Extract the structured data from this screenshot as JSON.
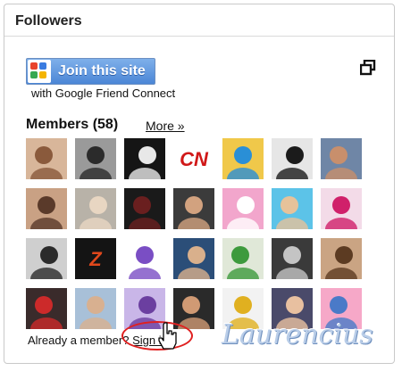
{
  "widget": {
    "title": "Followers",
    "join_button_label": "Join this site",
    "friend_connect_text": "with Google Friend Connect",
    "members_title": "Members (58)",
    "more_link": "More »",
    "footer_text": "Already a member? ",
    "sign_in_link": "Sign in",
    "watermark": "Laurencius"
  },
  "icons": {
    "logo": "google-friend-connect-icon",
    "popout": "popout-icon",
    "cursor": "hand-cursor-icon"
  },
  "colors": {
    "join_button": "#4b86d6",
    "highlight_circle": "#e02020",
    "watermark": "#b9cde8"
  },
  "members": [
    {
      "avatar": "#d8b69a",
      "accent": "#8a5a3c"
    },
    {
      "avatar": "#9a9a9a",
      "accent": "#2b2b2b"
    },
    {
      "avatar": "#151515",
      "accent": "#e8e8e8"
    },
    {
      "avatar": "#ffffff",
      "accent": "#d01818",
      "text": "CN"
    },
    {
      "avatar": "#f0c84a",
      "accent": "#2a8fd6"
    },
    {
      "avatar": "#e6e6e6",
      "accent": "#1b1b1b"
    },
    {
      "avatar": "#6f86a6",
      "accent": "#c88f6c"
    },
    {
      "avatar": "#c9a184",
      "accent": "#5a3a2a"
    },
    {
      "avatar": "#b8b2a8",
      "accent": "#e8d6c2"
    },
    {
      "avatar": "#1a1a1a",
      "accent": "#6a1f1f"
    },
    {
      "avatar": "#3b3b3b",
      "accent": "#d2a27f"
    },
    {
      "avatar": "#f2a6cc",
      "accent": "#ffffff"
    },
    {
      "avatar": "#5cc3e8",
      "accent": "#e6c29a"
    },
    {
      "avatar": "#f3dbe8",
      "accent": "#d0206a"
    },
    {
      "avatar": "#cfcfcf",
      "accent": "#2b2b2b"
    },
    {
      "avatar": "#141414",
      "accent": "#e0481c",
      "text": "Z"
    },
    {
      "avatar": "#ffffff",
      "accent": "#7a4ec4"
    },
    {
      "avatar": "#2b4e78",
      "accent": "#d9b08c"
    },
    {
      "avatar": "#e0e8d8",
      "accent": "#3d9a3d"
    },
    {
      "avatar": "#3a3a3a",
      "accent": "#c4c4c4"
    },
    {
      "avatar": "#caa483",
      "accent": "#5c3b22"
    },
    {
      "avatar": "#3a2b2b",
      "accent": "#cc2a2a"
    },
    {
      "avatar": "#a8c0d8",
      "accent": "#d8b090"
    },
    {
      "avatar": "#c9b6e8",
      "accent": "#6b3fa0"
    },
    {
      "avatar": "#2a2a2a",
      "accent": "#d09a74"
    },
    {
      "avatar": "#f2f2f2",
      "accent": "#e0b020"
    },
    {
      "avatar": "#4a4a6a",
      "accent": "#e8c0a0"
    },
    {
      "avatar": "#f6a8c8",
      "accent": "#4a7ac8"
    }
  ]
}
